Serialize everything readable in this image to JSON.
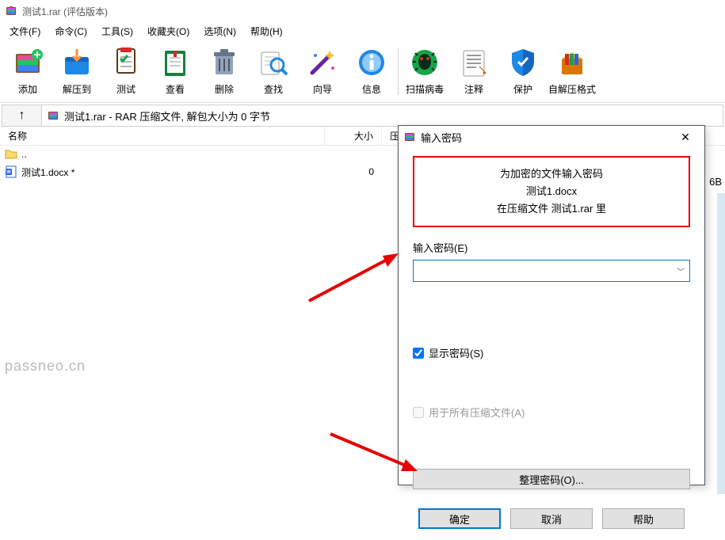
{
  "title": "测试1.rar (评估版本)",
  "menu": [
    "文件(F)",
    "命令(C)",
    "工具(S)",
    "收藏夹(O)",
    "选项(N)",
    "帮助(H)"
  ],
  "toolbar": [
    {
      "label": "添加",
      "icon": "add"
    },
    {
      "label": "解压到",
      "icon": "extract"
    },
    {
      "label": "测试",
      "icon": "test"
    },
    {
      "label": "查看",
      "icon": "view"
    },
    {
      "label": "删除",
      "icon": "delete"
    },
    {
      "label": "查找",
      "icon": "find"
    },
    {
      "label": "向导",
      "icon": "wizard"
    },
    {
      "label": "信息",
      "icon": "info"
    },
    {
      "label": "扫描病毒",
      "icon": "scan"
    },
    {
      "label": "注释",
      "icon": "comment"
    },
    {
      "label": "保护",
      "icon": "protect"
    },
    {
      "label": "自解压格式",
      "icon": "sfx"
    }
  ],
  "toolbar_sep_after": 7,
  "location": "测试1.rar - RAR 压缩文件, 解包大小为 0 字节",
  "upglyph": "↑",
  "columns": {
    "name": "名称",
    "size": "大小",
    "packed": "压缩"
  },
  "rows": [
    {
      "name": "..",
      "size": "",
      "icon": "folder-up"
    },
    {
      "name": "测试1.docx *",
      "size": "0",
      "icon": "docx"
    }
  ],
  "dialog": {
    "title": "输入密码",
    "msg_l1": "为加密的文件输入密码",
    "msg_l2": "测试1.docx",
    "msg_l3": "在压缩文件 测试1.rar 里",
    "pw_label": "输入密码(E)",
    "show_pw": "显示密码(S)",
    "use_all": "用于所有压缩文件(A)",
    "organize": "整理密码(O)...",
    "ok": "确定",
    "cancel": "取消",
    "help": "帮助"
  },
  "bg_text": "6B",
  "watermark": "passneo.cn"
}
